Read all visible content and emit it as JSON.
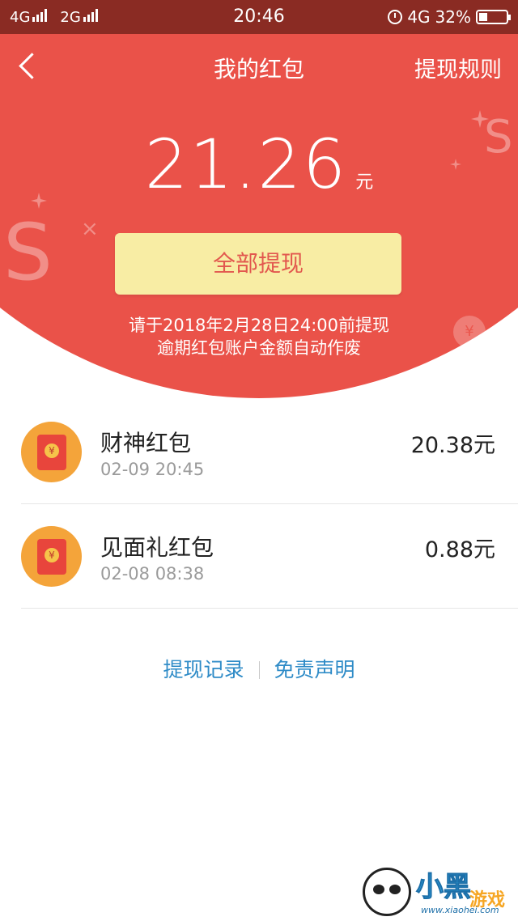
{
  "status_bar": {
    "signal_1": "4G",
    "signal_2": "2G",
    "time": "20:46",
    "network": "4G",
    "battery": "32%",
    "battery_level": 0.32
  },
  "nav": {
    "title": "我的红包",
    "rule_link": "提现规则"
  },
  "balance": {
    "amount": "21.26",
    "unit": "元"
  },
  "withdraw_button": "全部提现",
  "notice": {
    "line1": "请于2018年2月28日24:00前提现",
    "line2": "逾期红包账户金额自动作废"
  },
  "packets": [
    {
      "name": "财神红包",
      "time": "02-09 20:45",
      "amount": "20.38元",
      "icon": "red-envelope-icon"
    },
    {
      "name": "见面礼红包",
      "time": "02-08 08:38",
      "amount": "0.88元",
      "icon": "red-envelope-icon"
    }
  ],
  "links": {
    "records": "提现记录",
    "disclaimer": "免责声明"
  },
  "watermark": {
    "brand": "小黑",
    "brand_suffix": "游戏",
    "url": "www.xiaohei.com"
  },
  "colors": {
    "header_red": "#ea5249",
    "status_bar": "#8a2b23",
    "button_yellow": "#f8eda4",
    "link_blue": "#2e8bc7",
    "icon_orange": "#f4a43a"
  }
}
